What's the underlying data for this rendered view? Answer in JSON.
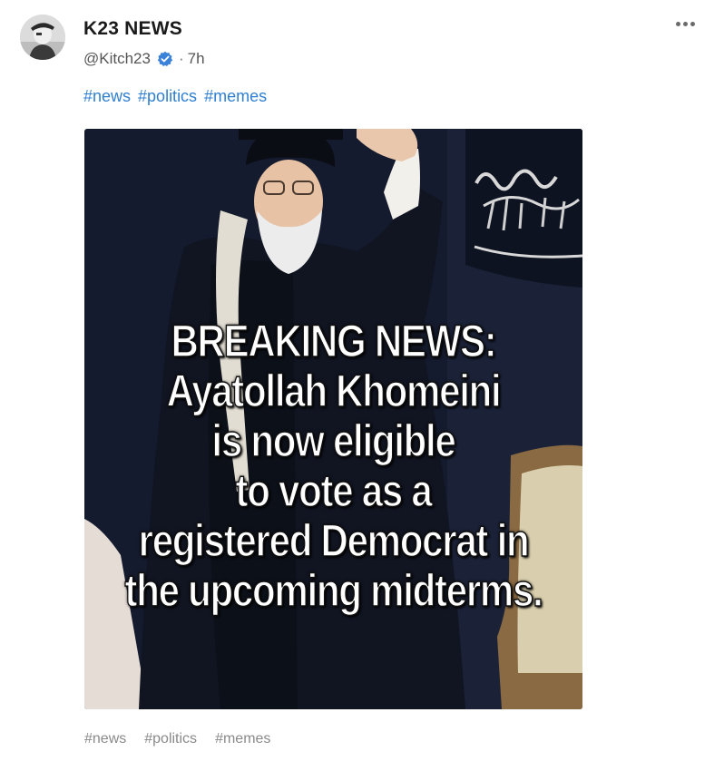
{
  "post": {
    "author_name": "K23 NEWS",
    "handle": "@Kitch23",
    "separator": "·",
    "time": "7h",
    "verified": true,
    "tags_top": [
      "#news",
      "#politics",
      "#memes"
    ],
    "tags_bottom": [
      "#news",
      "#politics",
      "#memes"
    ]
  },
  "image": {
    "caption_lines": [
      "BREAKING NEWS:",
      "Ayatollah Khomeini",
      "is now eligible",
      "to vote as a",
      "registered Democrat in",
      "the upcoming midterms."
    ]
  },
  "colors": {
    "hashtag_blue": "#2f7fd1",
    "verified_blue": "#3b82d9",
    "muted_gray": "#8a8a8a",
    "image_background": "#141a2c"
  },
  "icons": {
    "more": "more-horizontal-icon",
    "verified": "verified-badge-icon"
  }
}
